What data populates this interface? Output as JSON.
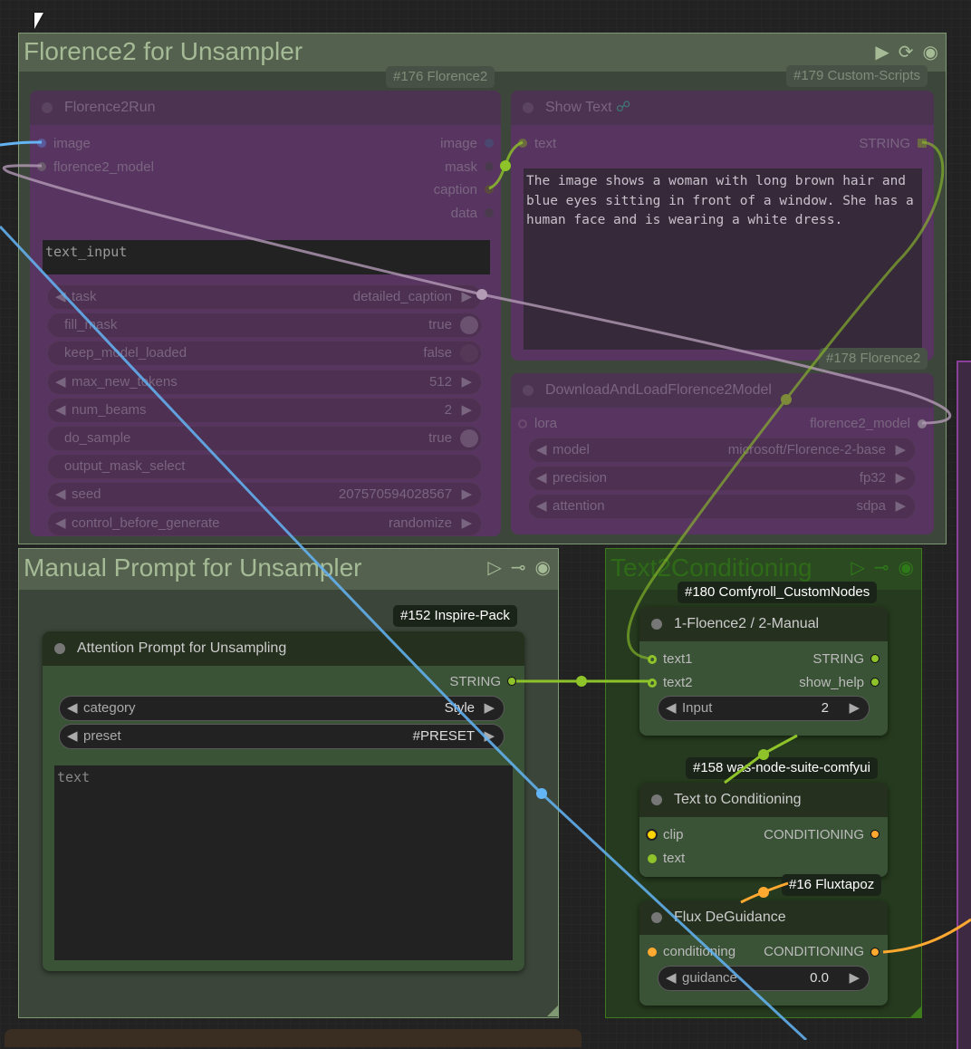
{
  "groups": {
    "florence": {
      "title": "Florence2 for Unsampler",
      "icons": [
        "play-icon",
        "bypass-icon",
        "eye-icon"
      ]
    },
    "manual": {
      "title": "Manual Prompt for Unsampler",
      "icons": [
        "play-outline-icon",
        "link-icon",
        "eye-icon"
      ]
    },
    "t2c": {
      "title": "Text2Conditioning",
      "icons": [
        "play-outline-icon",
        "link-icon",
        "eye-icon"
      ]
    }
  },
  "nodes": {
    "florence2run": {
      "badge": "#176 Florence2",
      "title": "Florence2Run",
      "inputs": [
        "image",
        "florence2_model"
      ],
      "outputs": [
        "image",
        "mask",
        "caption",
        "data"
      ],
      "text_input_placeholder": "text_input",
      "widgets": [
        {
          "label": "task",
          "value": "detailed_caption"
        },
        {
          "label": "fill_mask",
          "value": "true"
        },
        {
          "label": "keep_model_loaded",
          "value": "false"
        },
        {
          "label": "max_new_tokens",
          "value": "512"
        },
        {
          "label": "num_beams",
          "value": "2"
        },
        {
          "label": "do_sample",
          "value": "true"
        },
        {
          "label": "output_mask_select",
          "value": ""
        },
        {
          "label": "seed",
          "value": "207570594028567"
        },
        {
          "label": "control_before_generate",
          "value": "randomize"
        }
      ]
    },
    "showtext": {
      "badge": "#179 Custom-Scripts",
      "title": "Show Text",
      "input": "text",
      "output": "STRING",
      "text": "The image shows a woman with long brown hair and blue eyes sitting in front of a window. She has a human face and is wearing a white dress."
    },
    "loadmodel": {
      "badge": "#178 Florence2",
      "title": "DownloadAndLoadFlorence2Model",
      "input": "lora",
      "output": "florence2_model",
      "widgets": [
        {
          "label": "model",
          "value": "microsoft/Florence-2-base"
        },
        {
          "label": "precision",
          "value": "fp32"
        },
        {
          "label": "attention",
          "value": "sdpa"
        }
      ]
    },
    "attention": {
      "badge": "#152 Inspire-Pack",
      "title": "Attention Prompt for Unsampling",
      "output": "STRING",
      "widgets": [
        {
          "label": "category",
          "value": "Style"
        },
        {
          "label": "preset",
          "value": "#PRESET"
        }
      ],
      "text_placeholder": "text"
    },
    "switch": {
      "badge": "#180 Comfyroll_CustomNodes",
      "title": "1-Floence2 / 2-Manual",
      "inputs": [
        "text1",
        "text2"
      ],
      "outputs": [
        "STRING",
        "show_help"
      ],
      "widget": {
        "label": "Input",
        "value": "2"
      }
    },
    "t2c": {
      "badge": "#158 was-node-suite-comfyui",
      "title": "Text to Conditioning",
      "inputs": [
        "clip",
        "text"
      ],
      "output": "CONDITIONING"
    },
    "dg": {
      "badge": "#16 Fluxtapoz",
      "title": "Flux DeGuidance",
      "input": "conditioning",
      "output": "CONDITIONING",
      "widget": {
        "label": "guidance",
        "value": "0.0"
      }
    }
  },
  "colors": {
    "string": "#8fc32a",
    "image": "#64b5f6",
    "conditioning": "#ffa931",
    "clip": "#ffd500",
    "model": "#b39ab5"
  }
}
